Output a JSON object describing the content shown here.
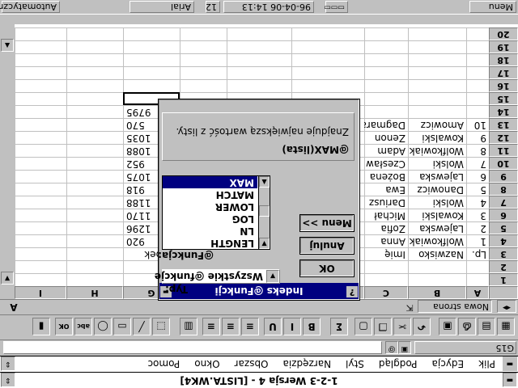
{
  "window": {
    "title": "1-2-3 Wersja 4 - [LISTA.WK4]"
  },
  "menu": {
    "items": [
      "Plik",
      "Edycja",
      "Podgląd",
      "Styl",
      "Narzędzia",
      "Obszar",
      "Okno",
      "Pomoc"
    ]
  },
  "address": {
    "cell": "G15"
  },
  "tabs": {
    "active": "A",
    "new_sheet": "Nowa strona"
  },
  "toolbar": {
    "icons": [
      "preview-icon",
      "save-icon",
      "print-icon",
      "save-disk-icon",
      "undo-icon",
      "cut-icon",
      "copy-icon",
      "paste-icon",
      "sum-icon",
      "bold-icon",
      "italic-icon",
      "underline-icon",
      "align-left-icon",
      "align-center-icon",
      "align-right-icon",
      "format-icon",
      "select-icon",
      "line-icon",
      "rect-icon",
      "ellipse-icon",
      "abc-icon",
      "ok-icon",
      "chart-icon"
    ]
  },
  "grid": {
    "columns": [
      "A",
      "B",
      "C",
      "D",
      "E",
      "F",
      "G",
      "H",
      "I"
    ],
    "rows": [
      {
        "n": "1",
        "cells": {}
      },
      {
        "n": "2",
        "cells": {}
      },
      {
        "n": "3",
        "cells": {
          "A": "Lp.",
          "B": "Nazwisko",
          "C": "Imię",
          "G": "...obek"
        }
      },
      {
        "n": "4",
        "cells": {
          "A": "1",
          "B": "Wolfkowiak",
          "C": "Anna",
          "G": "920"
        }
      },
      {
        "n": "5",
        "cells": {
          "A": "2",
          "B": "Lajewska",
          "C": "Zofia",
          "G": "1296"
        }
      },
      {
        "n": "6",
        "cells": {
          "A": "3",
          "B": "Kowalski",
          "C": "Michał",
          "G": "1170"
        }
      },
      {
        "n": "7",
        "cells": {
          "A": "4",
          "B": "Wolski",
          "C": "Dariusz",
          "G": "1188"
        }
      },
      {
        "n": "8",
        "cells": {
          "A": "5",
          "B": "Danowicz",
          "C": "Ewa",
          "G": "918"
        }
      },
      {
        "n": "9",
        "cells": {
          "A": "6",
          "B": "Lajewska",
          "C": "Bożena",
          "G": "1075"
        }
      },
      {
        "n": "10",
        "cells": {
          "A": "7",
          "B": "Wolski",
          "C": "Czesław",
          "G": "952"
        }
      },
      {
        "n": "11",
        "cells": {
          "A": "8",
          "B": "Wolfkowiak",
          "C": "Adam",
          "G": "1088"
        }
      },
      {
        "n": "12",
        "cells": {
          "A": "9",
          "B": "Kowalski",
          "C": "Zenon",
          "G": "1035"
        }
      },
      {
        "n": "13",
        "cells": {
          "A": "10",
          "B": "Amowicz",
          "C": "Dagmara",
          "G": "570"
        }
      },
      {
        "n": "14",
        "cells": {
          "G": "9795"
        }
      },
      {
        "n": "15",
        "cells": {}
      },
      {
        "n": "16",
        "cells": {}
      },
      {
        "n": "17",
        "cells": {}
      },
      {
        "n": "18",
        "cells": {}
      },
      {
        "n": "19",
        "cells": {}
      },
      {
        "n": "20",
        "cells": {}
      }
    ]
  },
  "dialog": {
    "title": "Indeks @Funkcji",
    "type_label": "Typ:",
    "type_value": "Wszystkie @funkcje",
    "func_label": "@Funkcja:",
    "functions": [
      "LENGTH",
      "LN",
      "LOG",
      "LOWER",
      "MATCH",
      "MAX"
    ],
    "selected": "MAX",
    "syntax": "@MAX(lista)",
    "description": "Znajduje największą wartość z listy.",
    "ok": "OK",
    "cancel": "Anuluj",
    "menu": "Menu >>"
  },
  "status": {
    "mode": "Automatyczny",
    "font": "Arial",
    "size": "12",
    "datetime": "96-04-06 14:13",
    "ready": "Menu"
  }
}
